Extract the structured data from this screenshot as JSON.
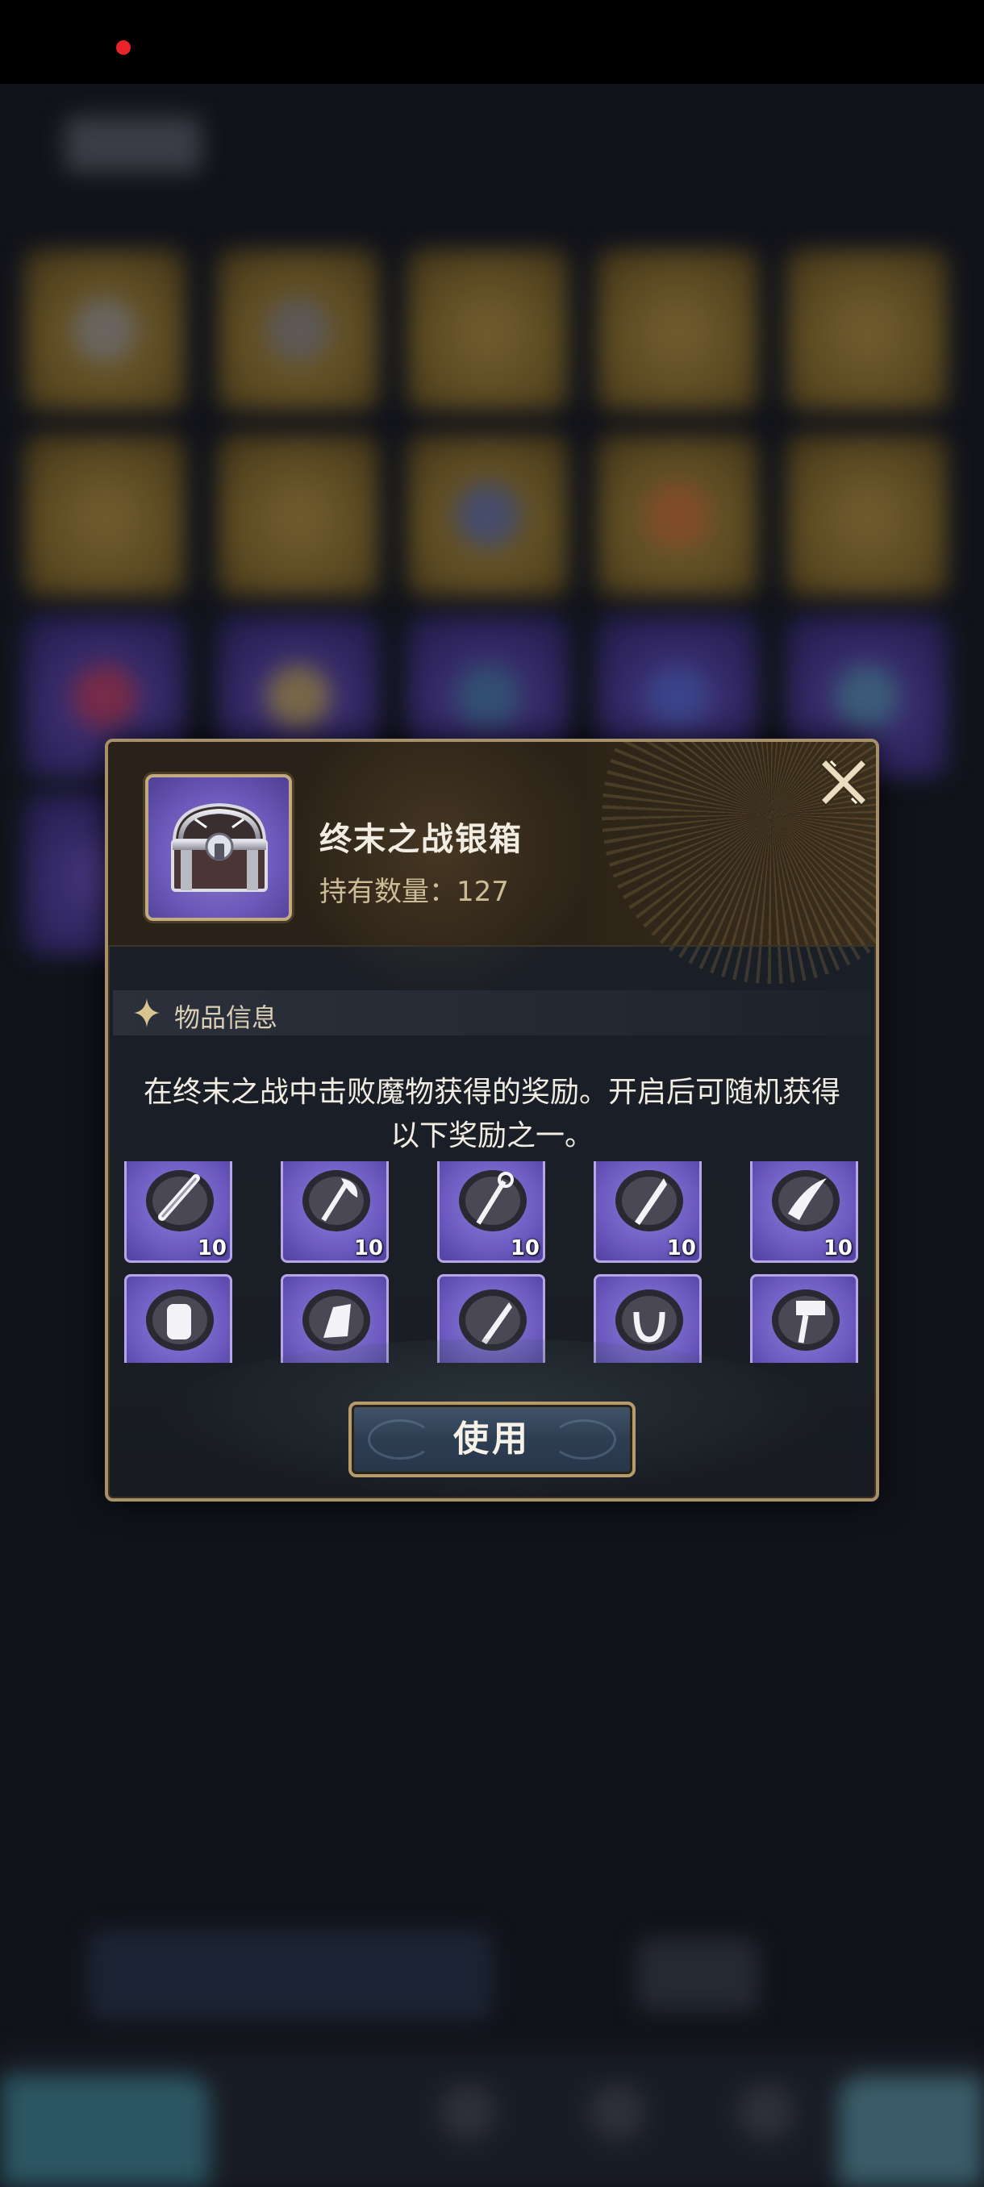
{
  "status_bar": {
    "recording_indicator_color": "#e8242a"
  },
  "dialog": {
    "item_name": "终末之战银箱",
    "count_label": "持有数量：",
    "count_value": "127",
    "section_title": "物品信息",
    "description": "在终末之战中击败魔物获得的奖励。开启后可随机获得以下奖励之一。",
    "use_button_label": "使用",
    "close_icon": "close-icon",
    "item_icon": "silver-chest-icon",
    "rewards": [
      {
        "icon": "tube-material-icon",
        "quantity": "10"
      },
      {
        "icon": "axe-material-icon",
        "quantity": "10"
      },
      {
        "icon": "staff-material-icon",
        "quantity": "10"
      },
      {
        "icon": "blade-material-icon",
        "quantity": "10"
      },
      {
        "icon": "claw-material-icon",
        "quantity": "10"
      },
      {
        "icon": "gauntlet-material-icon",
        "quantity": ""
      },
      {
        "icon": "fist-material-icon",
        "quantity": ""
      },
      {
        "icon": "dagger-material-icon",
        "quantity": ""
      },
      {
        "icon": "horseshoe-material-icon",
        "quantity": ""
      },
      {
        "icon": "hammer-material-icon",
        "quantity": ""
      }
    ]
  },
  "colors": {
    "frame_gold": "#a8916a",
    "reward_purple": "#6d5bc1",
    "text_light": "#f1ede2",
    "text_tan": "#cdbd97"
  }
}
